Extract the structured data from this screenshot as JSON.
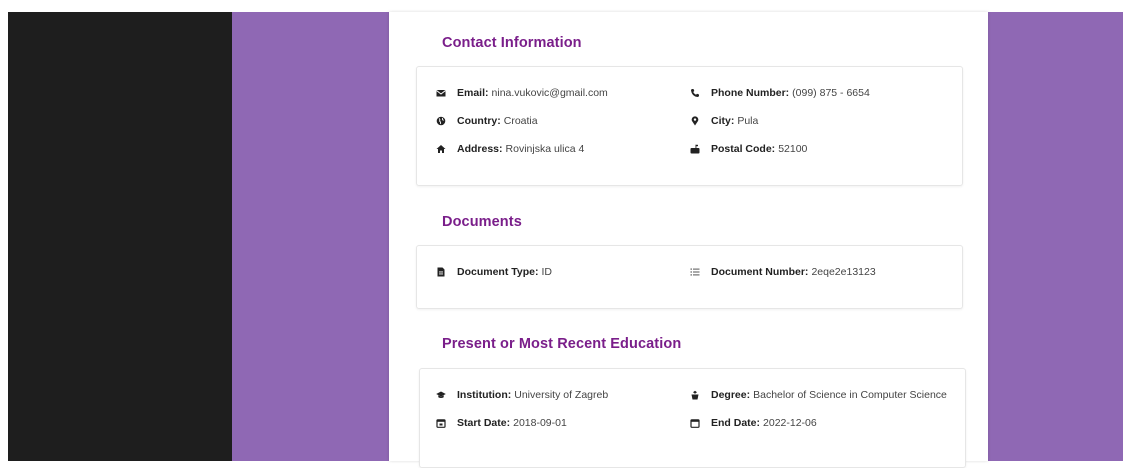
{
  "theme": {
    "accent": "#7a1e8a",
    "background_purple": "#8f68b4",
    "background_dark": "#1e1e1e"
  },
  "contact": {
    "title": "Contact Information",
    "email": {
      "label": "Email:",
      "value": "nina.vukovic@gmail.com",
      "icon": "envelope-icon"
    },
    "phone": {
      "label": "Phone Number:",
      "value": "(099) 875 - 6654",
      "icon": "phone-icon"
    },
    "country": {
      "label": "Country:",
      "value": "Croatia",
      "icon": "globe-icon"
    },
    "city": {
      "label": "City:",
      "value": "Pula",
      "icon": "map-pin-icon"
    },
    "address": {
      "label": "Address:",
      "value": "Rovinjska ulica 4",
      "icon": "home-icon"
    },
    "postal_code": {
      "label": "Postal Code:",
      "value": "52100",
      "icon": "mailbox-icon"
    }
  },
  "documents": {
    "title": "Documents",
    "type": {
      "label": "Document Type:",
      "value": "ID",
      "icon": "file-icon"
    },
    "number": {
      "label": "Document Number:",
      "value": "2eqe2e13123",
      "icon": "list-icon"
    }
  },
  "education": {
    "title": "Present or Most Recent Education",
    "institution": {
      "label": "Institution:",
      "value": "University of Zagreb",
      "icon": "graduation-cap-icon"
    },
    "degree": {
      "label": "Degree:",
      "value": "Bachelor of Science in Computer Science",
      "icon": "degree-icon"
    },
    "start_date": {
      "label": "Start Date:",
      "value": "2018-09-01",
      "icon": "calendar-icon"
    },
    "end_date": {
      "label": "End Date:",
      "value": "2022-12-06",
      "icon": "calendar-icon"
    }
  }
}
